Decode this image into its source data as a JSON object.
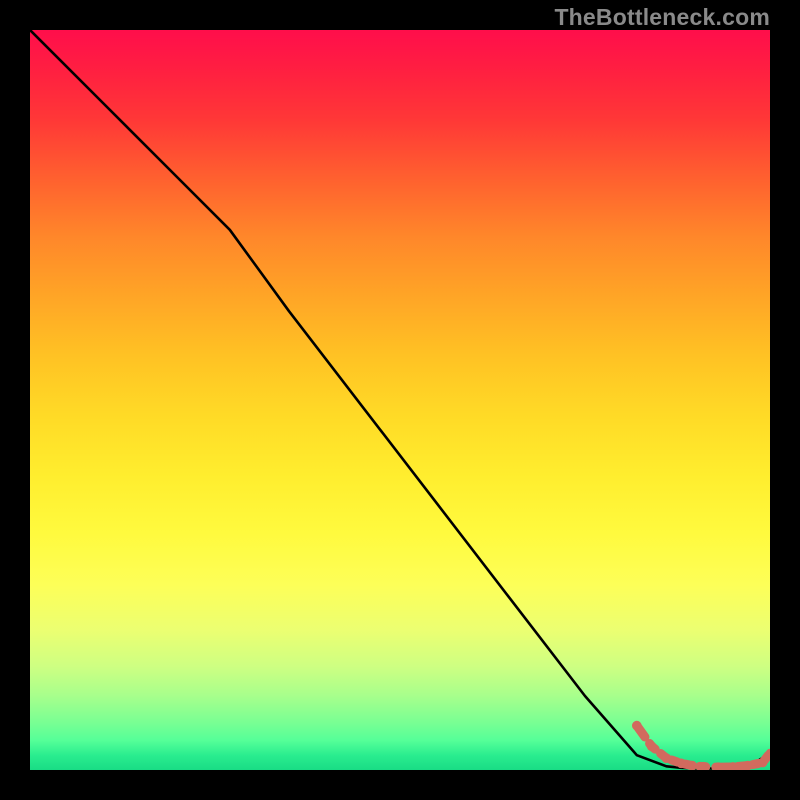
{
  "watermark": "TheBottleneck.com",
  "colors": {
    "background": "#000000",
    "line": "#000000",
    "dots": "#D16A5E"
  },
  "chart_data": {
    "type": "line",
    "title": "",
    "xlabel": "",
    "ylabel": "",
    "xlim": [
      0,
      100
    ],
    "ylim": [
      0,
      100
    ],
    "grid": false,
    "series": [
      {
        "name": "bottleneck-curve",
        "x": [
          0,
          10,
          20,
          27,
          35,
          45,
          55,
          65,
          75,
          82,
          86,
          88,
          90,
          92,
          94,
          96,
          98,
          100
        ],
        "y": [
          100,
          90,
          80,
          73,
          62,
          49,
          36,
          23,
          10,
          2,
          0.5,
          0.3,
          0.2,
          0.2,
          0.3,
          0.5,
          1.0,
          2.3
        ]
      }
    ],
    "highlight_tail_dots": {
      "name": "tail-dots",
      "x": [
        82,
        84,
        86,
        88,
        89.5,
        91,
        93,
        95,
        97,
        99,
        100
      ],
      "y": [
        6,
        3.2,
        1.6,
        0.9,
        0.6,
        0.45,
        0.38,
        0.42,
        0.6,
        1.0,
        2.3
      ]
    }
  }
}
